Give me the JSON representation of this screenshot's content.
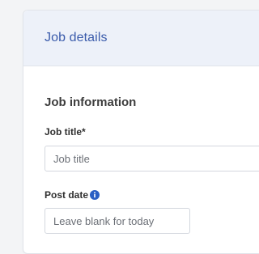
{
  "header": {
    "title": "Job details"
  },
  "section": {
    "heading": "Job information"
  },
  "fields": {
    "job_title": {
      "label": "Job title*",
      "placeholder": "Job title",
      "value": ""
    },
    "post_date": {
      "label": "Post date",
      "placeholder": "Leave blank for today",
      "value": "",
      "info_icon": "info-icon"
    }
  },
  "colors": {
    "accent": "#3a5bab",
    "header_bg": "#edf1f9",
    "info_icon": "#2b5fc4",
    "page_bg": "#f3f4f6"
  }
}
